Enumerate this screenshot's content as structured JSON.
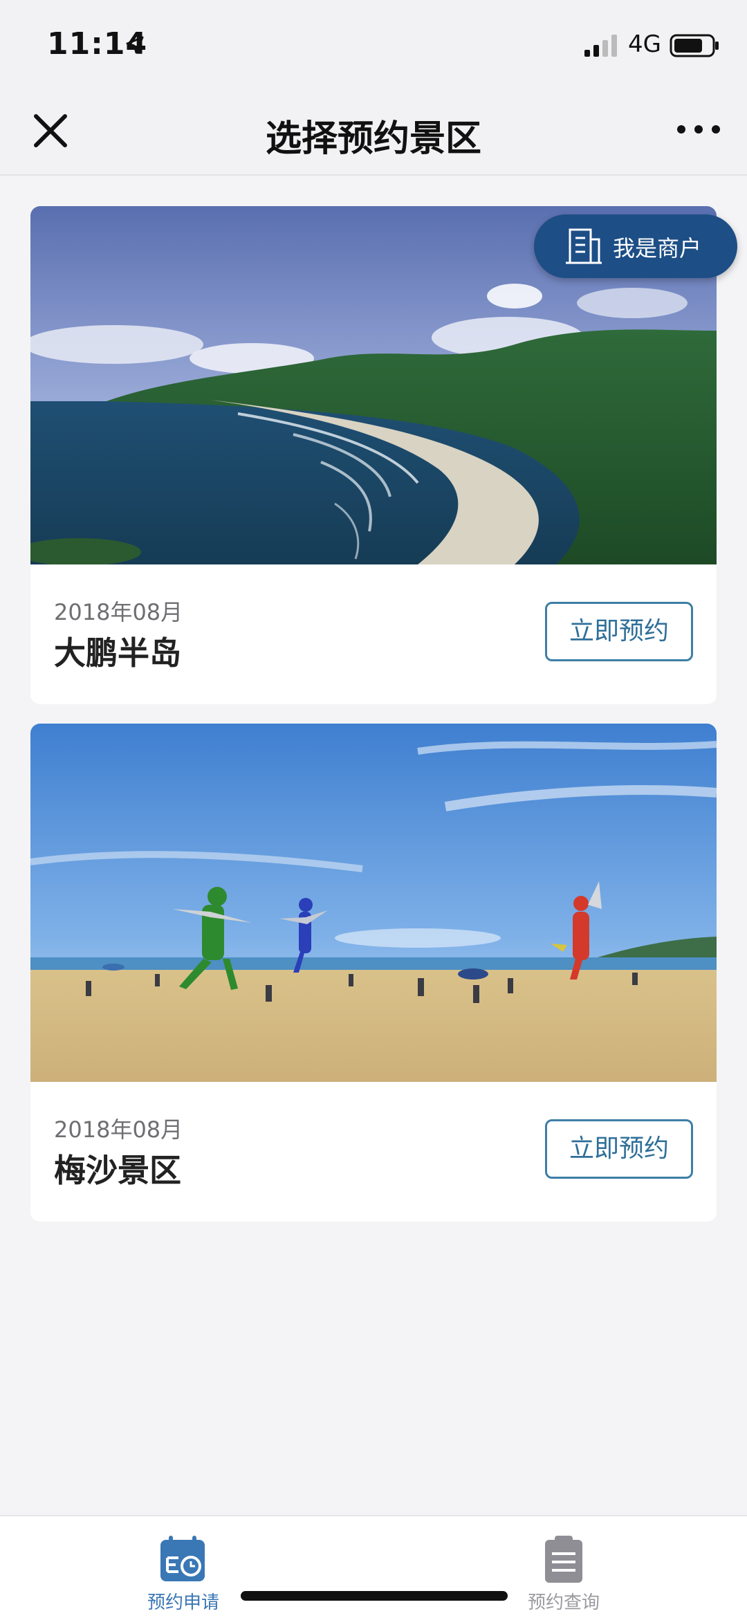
{
  "status_bar": {
    "time": "11:14",
    "network": "4G",
    "icons": [
      "location-arrow-icon",
      "signal-icon",
      "battery-icon"
    ]
  },
  "nav": {
    "title": "选择预约景区",
    "left_icon": "close-icon",
    "right_icon": "more-icon"
  },
  "merchant_badge": {
    "label": "我是商户",
    "icon": "building-icon",
    "color": "#1d4e86"
  },
  "scenic_spots": [
    {
      "date": "2018年08月",
      "name": "大鹏半岛",
      "button_label": "立即预约",
      "image": "coastline-photo"
    },
    {
      "date": "2018年08月",
      "name": "梅沙景区",
      "button_label": "立即预约",
      "image": "beach-sculptures-photo"
    }
  ],
  "tab_bar": {
    "tabs": [
      {
        "label": "预约申请",
        "icon": "calendar-clock-icon",
        "active": true
      },
      {
        "label": "预约查询",
        "icon": "clipboard-icon",
        "active": false
      }
    ],
    "active_color": "#3a77b5",
    "inactive_color": "#9a9aa0"
  },
  "colors": {
    "accent": "#3d7ea6",
    "background": "#f4f4f6"
  }
}
